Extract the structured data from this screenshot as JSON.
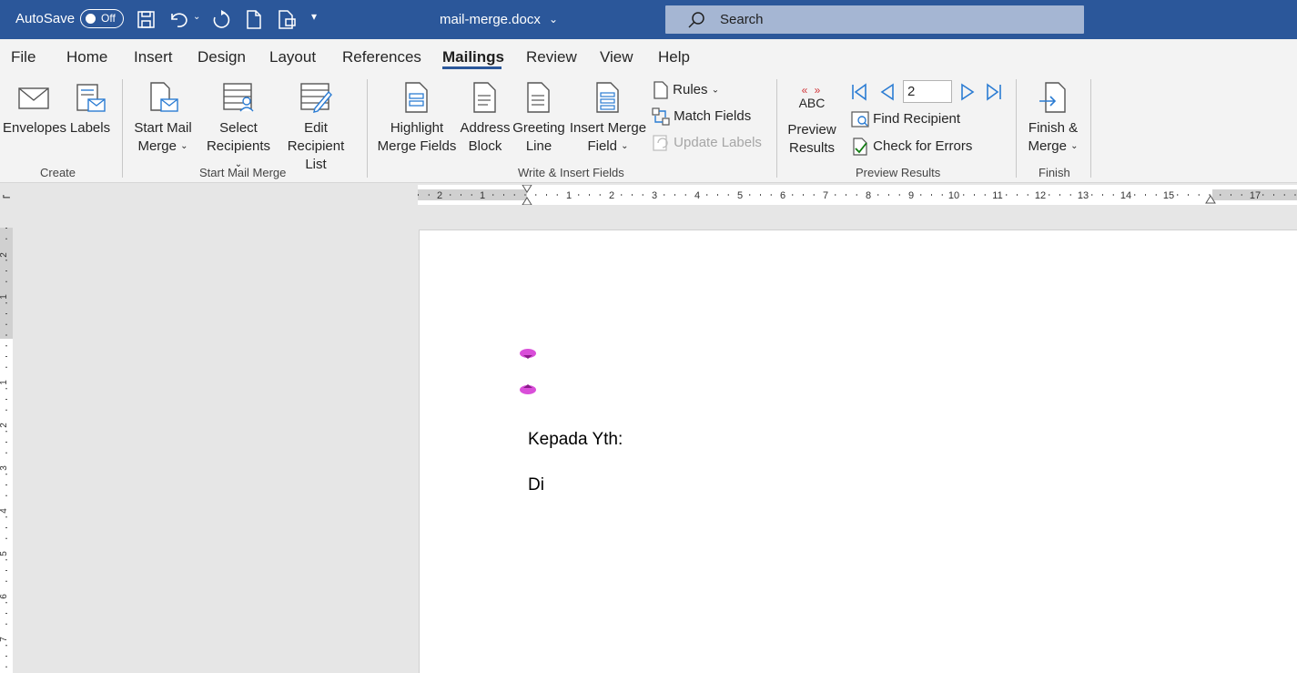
{
  "titlebar": {
    "autosave_label": "AutoSave",
    "autosave_state": "Off",
    "filename": "mail-merge.docx",
    "search_placeholder": "Search",
    "accent_color": "#2b579a"
  },
  "tabs": [
    {
      "label": "File"
    },
    {
      "label": "Home"
    },
    {
      "label": "Insert"
    },
    {
      "label": "Design"
    },
    {
      "label": "Layout"
    },
    {
      "label": "References"
    },
    {
      "label": "Mailings",
      "active": true
    },
    {
      "label": "Review"
    },
    {
      "label": "View"
    },
    {
      "label": "Help"
    }
  ],
  "ribbon": {
    "create": {
      "group_label": "Create",
      "envelopes": "Envelopes",
      "labels": "Labels"
    },
    "start_mail_merge": {
      "group_label": "Start Mail Merge",
      "start_line1": "Start Mail",
      "start_line2": "Merge",
      "select_line1": "Select",
      "select_line2": "Recipients",
      "edit_line1": "Edit",
      "edit_line2": "Recipient List"
    },
    "write_insert": {
      "group_label": "Write & Insert Fields",
      "highlight_line1": "Highlight",
      "highlight_line2": "Merge Fields",
      "address_line1": "Address",
      "address_line2": "Block",
      "greeting_line1": "Greeting",
      "greeting_line2": "Line",
      "insert_line1": "Insert Merge",
      "insert_line2": "Field",
      "rules": "Rules",
      "match_fields": "Match Fields",
      "update_labels": "Update Labels"
    },
    "preview": {
      "group_label": "Preview Results",
      "preview_line1": "Preview",
      "preview_line2": "Results",
      "abc": "ABC",
      "record_number": "2",
      "find_recipient": "Find Recipient",
      "check_errors": "Check for Errors"
    },
    "finish": {
      "group_label": "Finish",
      "finish_line1": "Finish &",
      "finish_line2": "Merge"
    }
  },
  "ruler": {
    "h_ticks": [
      "2",
      "1",
      "1",
      "2",
      "3",
      "4",
      "5",
      "6",
      "7",
      "8",
      "9",
      "10",
      "11",
      "12",
      "13",
      "14",
      "15",
      "17"
    ],
    "v_ticks": [
      "2",
      "1",
      "1",
      "2",
      "3",
      "4",
      "5",
      "6",
      "7"
    ]
  },
  "document": {
    "line1": "Kepada Yth:",
    "line2": "Di",
    "field_marker_color": "#cc33cc"
  }
}
